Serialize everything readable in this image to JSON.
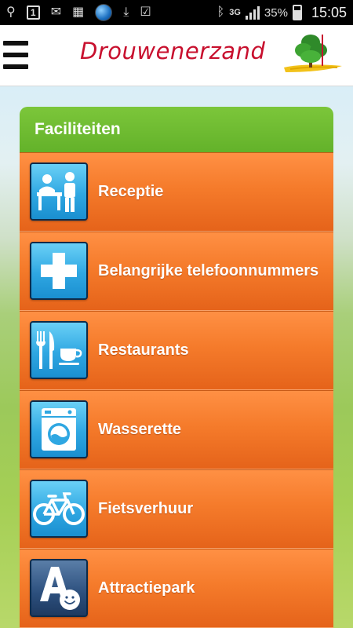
{
  "status_bar": {
    "notification_box": "1",
    "network": "3G",
    "battery_percent": "35%",
    "time": "15:05"
  },
  "header": {
    "title": "Drouwenerzand"
  },
  "panel": {
    "title": "Faciliteiten",
    "items": [
      {
        "label": "Receptie",
        "icon": "reception-icon"
      },
      {
        "label": "Belangrijke telefoonnummers",
        "icon": "first-aid-cross-icon"
      },
      {
        "label": "Restaurants",
        "icon": "cutlery-cup-icon"
      },
      {
        "label": "Wasserette",
        "icon": "washing-machine-icon"
      },
      {
        "label": "Fietsverhuur",
        "icon": "bicycle-icon"
      },
      {
        "label": "Attractiepark",
        "icon": "attraction-park-icon"
      }
    ]
  },
  "colors": {
    "header_green": "#6ab833",
    "row_orange": "#f57b2b",
    "icon_blue": "#2fa7e2",
    "brand_red": "#c8102e"
  }
}
